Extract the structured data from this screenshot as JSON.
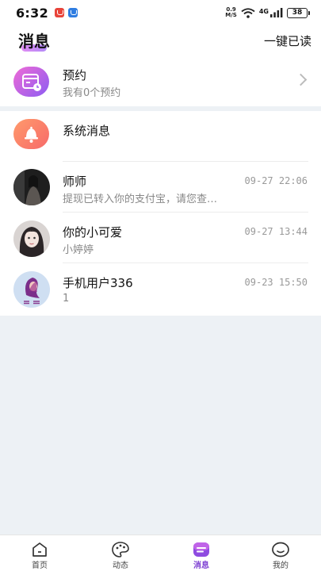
{
  "status_bar": {
    "time": "6:32",
    "net_speed_value": "0.9",
    "net_speed_unit": "M/S",
    "network": "4G",
    "battery": "38"
  },
  "header": {
    "title": "消息",
    "mark_all_read": "一键已读"
  },
  "reservation": {
    "title": "预约",
    "subtitle": "我有0个预约"
  },
  "system": {
    "title": "系统消息"
  },
  "conversations": [
    {
      "name": "师师",
      "time": "09-27 22:06",
      "preview": "提现已转入你的支付宝，请您查…"
    },
    {
      "name": "你的小可爱",
      "time": "09-27 13:44",
      "preview": "小婷婷"
    },
    {
      "name": "手机用户336",
      "time": "09-23 15:50",
      "preview": "1"
    }
  ],
  "bottom_nav": {
    "items": [
      {
        "label": "首页",
        "icon": "home-icon"
      },
      {
        "label": "动态",
        "icon": "palette-icon"
      },
      {
        "label": "消息",
        "icon": "message-icon"
      },
      {
        "label": "我的",
        "icon": "profile-icon"
      }
    ],
    "active_index": 2
  },
  "colors": {
    "accent": "#7d3fd2",
    "reservation_gradient": [
      "#ef6bd6",
      "#8c5cf2"
    ],
    "system_gradient": [
      "#ff9a6b",
      "#f76a6a"
    ],
    "page_background": "#edf1f5"
  }
}
